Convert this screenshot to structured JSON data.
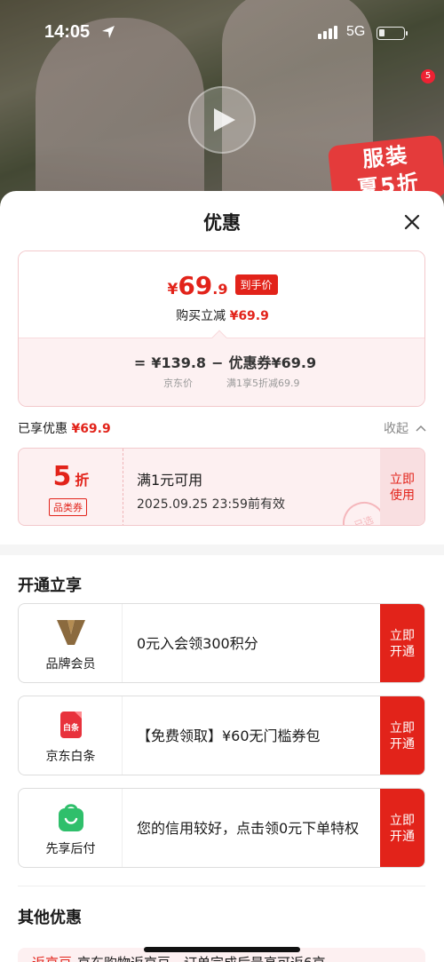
{
  "status_bar": {
    "time": "14:05",
    "network": "5G"
  },
  "hero": {
    "promo_text": "服装\n夏5折",
    "badge": "5"
  },
  "sheet": {
    "title": "优惠"
  },
  "price_card": {
    "currency": "¥",
    "final_int": "69",
    "final_dec": ".9",
    "final_tag": "到手价",
    "instant_label": "购买立减",
    "instant_value": "¥69.9",
    "formula_eq": "=",
    "jd_price": "¥139.8",
    "formula_minus": "−",
    "coupon_part": "优惠券¥69.9",
    "jd_price_label": "京东价",
    "coupon_rule": "满1享5折减69.9"
  },
  "enjoyed": {
    "label": "已享优惠",
    "value": "¥69.9",
    "collapse_label": "收起"
  },
  "coupon": {
    "discount": "5",
    "unit": "折",
    "category": "品类券",
    "condition": "满1元可用",
    "valid_until": "2025.09.25 23:59前有效",
    "use_button": "立即\n使用",
    "stamp": "已选"
  },
  "open_section": {
    "title": "开通立享",
    "items": [
      {
        "label": "品牌会员",
        "desc": "0元入会领300积分",
        "button": "立即\n开通",
        "icon": "brand-member-icon"
      },
      {
        "label": "京东白条",
        "desc": "【免费领取】¥60无门槛券包",
        "button": "立即\n开通",
        "icon": "jd-baitiao-icon",
        "icon_text": "白条"
      },
      {
        "label": "先享后付",
        "desc": "您的信用较好，点击领0元下单特权",
        "button": "立即\n开通",
        "icon": "pay-later-icon"
      }
    ]
  },
  "other_section": {
    "title": "其他优惠",
    "row_tag": "返京豆",
    "row_text": "京东购物返京豆，订单完成后最高可返6京"
  },
  "colors": {
    "accent": "#e2231a",
    "card_bg": "#fdf0f1",
    "member_gold": "#8b6a3e",
    "baitiao_red": "#e8323c",
    "paylater_green": "#2fbf6b"
  }
}
